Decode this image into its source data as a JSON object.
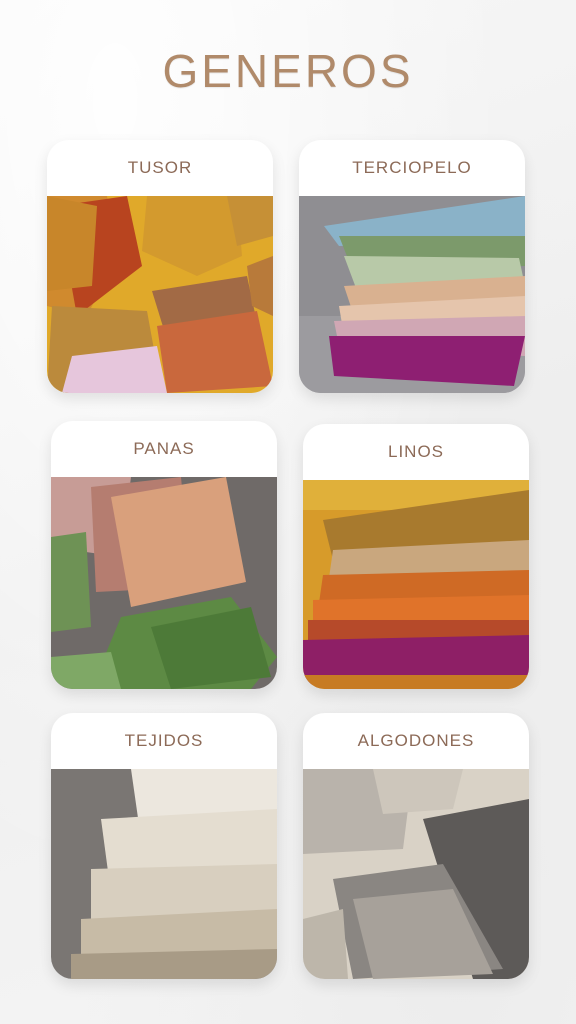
{
  "page": {
    "title": "GENEROS"
  },
  "categories": [
    {
      "label": "TUSOR"
    },
    {
      "label": "TERCIOPELO"
    },
    {
      "label": "PANAS"
    },
    {
      "label": "LINOS"
    },
    {
      "label": "TEJIDOS"
    },
    {
      "label": "ALGODONES"
    }
  ]
}
